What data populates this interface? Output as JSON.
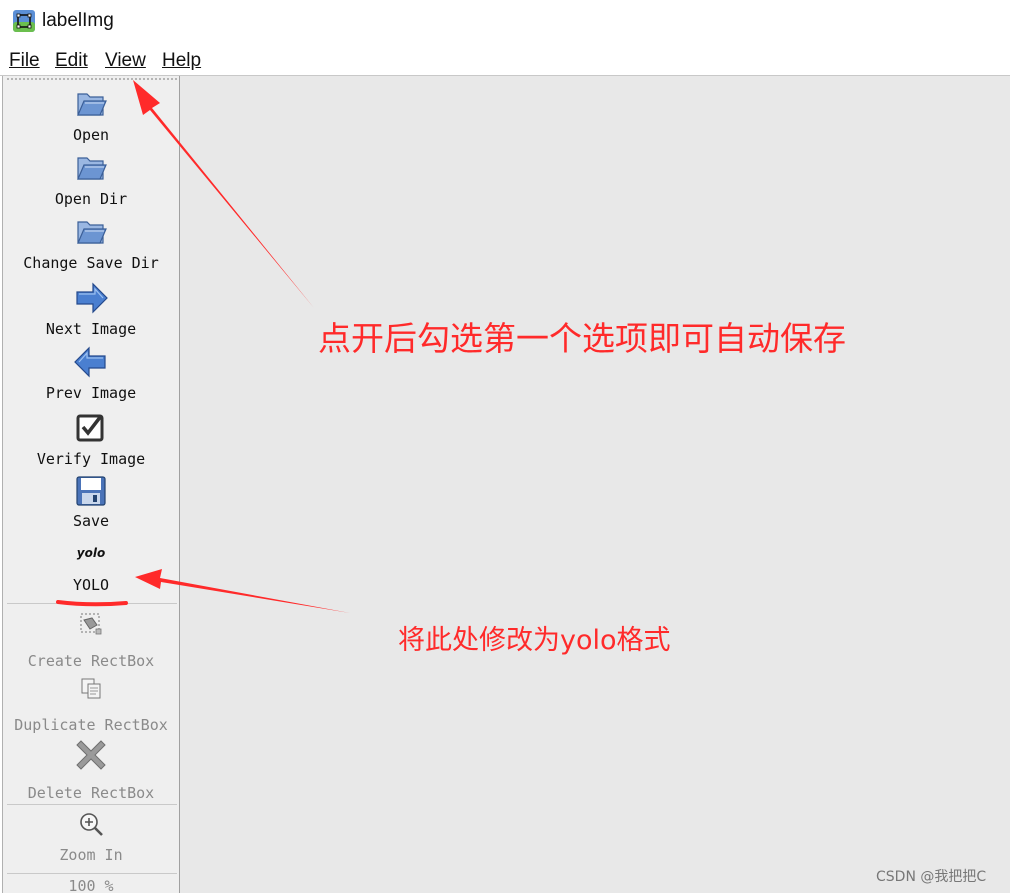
{
  "window": {
    "title": "labelImg",
    "app_icon": "labelimg-app-icon"
  },
  "menubar": {
    "items": [
      {
        "label": "File"
      },
      {
        "label": "Edit"
      },
      {
        "label": "View"
      },
      {
        "label": "Help"
      }
    ]
  },
  "toolbar": {
    "open": "Open",
    "open_dir": "Open Dir",
    "change_save_dir": "Change Save Dir",
    "next_image": "Next Image",
    "prev_image": "Prev Image",
    "verify_image": "Verify Image",
    "save": "Save",
    "yolo_icon_text": "yolo",
    "yolo": "YOLO",
    "create_rectbox": "Create RectBox",
    "duplicate_rectbox": "Duplicate RectBox",
    "delete_rectbox": "Delete RectBox",
    "zoom_in": "Zoom In",
    "zoom_value": "100 %"
  },
  "annotations": {
    "top_note": "点开后勾选第一个选项即可自动保存",
    "bottom_note": "将此处修改为yolo格式",
    "color": "#ff2a2a"
  },
  "watermark": "CSDN @我把把C",
  "colors": {
    "canvas_bg": "#e8e8e8",
    "toolbar_bg": "#efefef",
    "folder_blue": "#5a86c8",
    "arrow_blue": "#3d72c9",
    "annotation_red": "#ff2a2a"
  }
}
